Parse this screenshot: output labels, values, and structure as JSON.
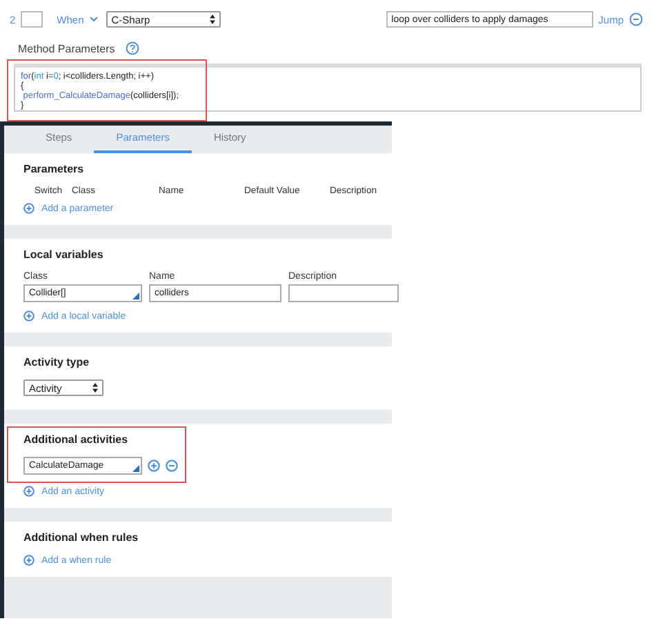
{
  "step": {
    "number": "2",
    "condition": "When",
    "language": "C-Sharp",
    "description": "loop over colliders to apply damages",
    "jump": "Jump"
  },
  "method_parameters": {
    "label": "Method Parameters",
    "highlighted": true,
    "code_lines": [
      [
        {
          "text": "for",
          "kind": "keyword"
        },
        {
          "text": "(",
          "kind": "plain"
        },
        {
          "text": "int",
          "kind": "type"
        },
        {
          "text": " i=",
          "kind": "plain"
        },
        {
          "text": "0",
          "kind": "number"
        },
        {
          "text": "; i<colliders.Length; i++)",
          "kind": "plain"
        }
      ],
      [
        {
          "text": "{",
          "kind": "plain"
        }
      ],
      [
        {
          "text": " perform_CalculateDamage",
          "kind": "method"
        },
        {
          "text": "(colliders[i]);",
          "kind": "plain"
        }
      ],
      [
        {
          "text": "}",
          "kind": "plain"
        }
      ]
    ]
  },
  "tabs": [
    {
      "label": "Steps",
      "selected": false
    },
    {
      "label": "Parameters",
      "selected": true
    },
    {
      "label": "History",
      "selected": false
    }
  ],
  "parameters": {
    "title": "Parameters",
    "columns": [
      "Switch",
      "Class",
      "Name",
      "Default Value",
      "Description"
    ],
    "add_link": "Add a parameter"
  },
  "local_variables": {
    "title": "Local variables",
    "columns": [
      "Class",
      "Name",
      "Description"
    ],
    "rows": [
      {
        "class": "Collider[]",
        "name": "colliders"
      }
    ],
    "add_link": "Add a local variable"
  },
  "activity_type": {
    "title": "Activity type",
    "value": "Activity"
  },
  "additional_activities": {
    "title": "Additional activities",
    "highlighted": true,
    "items": [
      "CalculateDamage"
    ],
    "add_link": "Add an activity"
  },
  "additional_when_rules": {
    "title": "Additional when rules",
    "add_link": "Add a when rule"
  }
}
